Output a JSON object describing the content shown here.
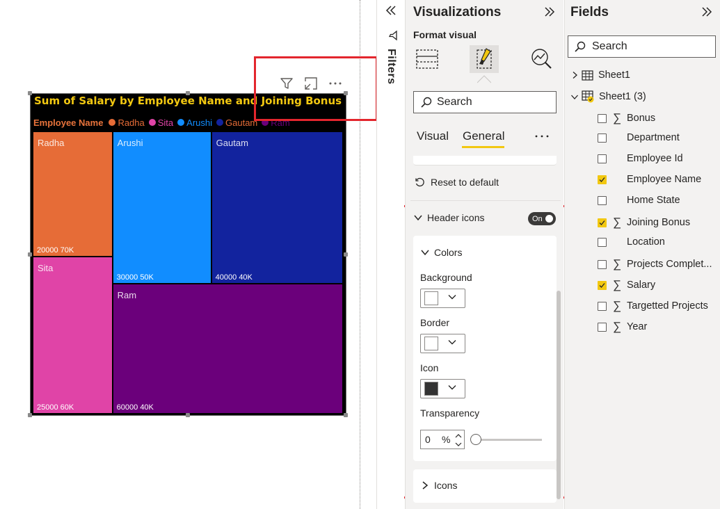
{
  "canvas": {
    "header_icons": [
      "filter-icon",
      "focus-mode-icon",
      "more-options-icon"
    ]
  },
  "chart_data": {
    "type": "treemap",
    "title": "Sum of Salary by Employee Name and Joining Bonus",
    "legend_title": "Employee Name",
    "legend": [
      {
        "name": "Radha",
        "color": "#e66c37"
      },
      {
        "name": "Sita",
        "color": "#e044a7"
      },
      {
        "name": "Arushi",
        "color": "#118dff"
      },
      {
        "name": "Gautam",
        "color": "#12239e"
      },
      {
        "name": "Ram",
        "color": "#6b007b"
      }
    ],
    "tiles": [
      {
        "name": "Radha",
        "salary": 20000,
        "joining_bonus": "70K",
        "value_label": "20000 70K",
        "color": "#e66c37"
      },
      {
        "name": "Sita",
        "salary": 25000,
        "joining_bonus": "60K",
        "value_label": "25000 60K",
        "color": "#e044a7"
      },
      {
        "name": "Arushi",
        "salary": 30000,
        "joining_bonus": "50K",
        "value_label": "30000 50K",
        "color": "#118dff"
      },
      {
        "name": "Gautam",
        "salary": 40000,
        "joining_bonus": "40K",
        "value_label": "40000 40K",
        "color": "#12239e"
      },
      {
        "name": "Ram",
        "salary": 60000,
        "joining_bonus": "40K",
        "value_label": "60000 40K",
        "color": "#6b007b"
      }
    ],
    "background": "#000000",
    "title_color": "#f2c811"
  },
  "filters": {
    "label": "Filters"
  },
  "visualizations": {
    "title": "Visualizations",
    "subtitle": "Format visual",
    "search_placeholder": "Search",
    "tabs": [
      "Visual",
      "General"
    ],
    "active_tab": "General",
    "reset_label": "Reset to default",
    "header_icons_section": {
      "label": "Header icons",
      "toggle": "On",
      "colors": {
        "label": "Colors",
        "background_label": "Background",
        "background_value": "#ffffff",
        "border_label": "Border",
        "border_value": "#ffffff",
        "icon_label": "Icon",
        "icon_value": "#333333",
        "transparency_label": "Transparency",
        "transparency_value": "0",
        "transparency_unit": "%"
      },
      "icons_label": "Icons"
    }
  },
  "fields": {
    "title": "Fields",
    "search_placeholder": "Search",
    "tables": [
      {
        "name": "Sheet1",
        "expanded": false
      },
      {
        "name": "Sheet1 (3)",
        "expanded": true
      }
    ],
    "items": [
      {
        "name": "Bonus",
        "sigma": true,
        "checked": false
      },
      {
        "name": "Department",
        "sigma": false,
        "checked": false
      },
      {
        "name": "Employee Id",
        "sigma": false,
        "checked": false
      },
      {
        "name": "Employee Name",
        "sigma": false,
        "checked": true
      },
      {
        "name": "Home State",
        "sigma": false,
        "checked": false
      },
      {
        "name": "Joining Bonus",
        "sigma": true,
        "checked": true
      },
      {
        "name": "Location",
        "sigma": false,
        "checked": false
      },
      {
        "name": "Projects Complet...",
        "sigma": true,
        "checked": false
      },
      {
        "name": "Salary",
        "sigma": true,
        "checked": true
      },
      {
        "name": "Targetted Projects",
        "sigma": true,
        "checked": false
      },
      {
        "name": "Year",
        "sigma": true,
        "checked": false
      }
    ]
  },
  "colors": {
    "accent": "#f2c811",
    "highlight": "#e3262d"
  }
}
